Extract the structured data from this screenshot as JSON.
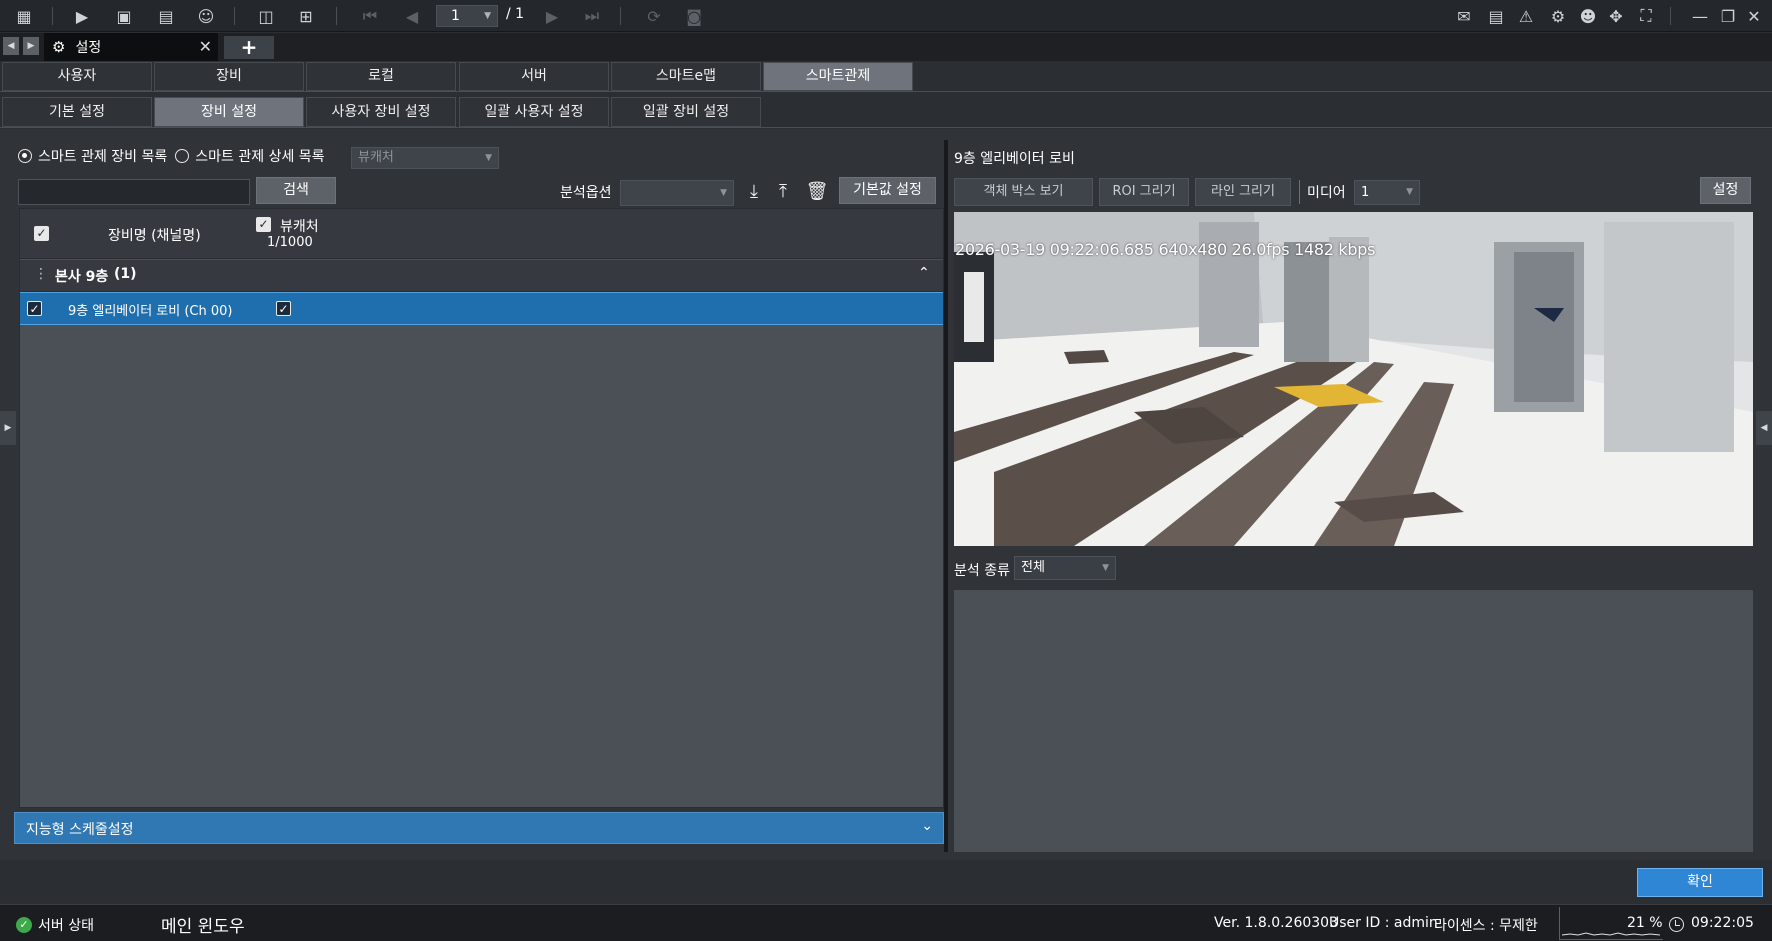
{
  "toolbar": {
    "page_current": "1",
    "page_total": "/ 1",
    "icons": [
      "grid-icon",
      "play-icon",
      "playback-search-icon",
      "export-icon",
      "person-search-icon",
      "layout-icon",
      "add-monitor-icon",
      "first-page-icon",
      "prev-page-icon",
      "next-page-icon",
      "last-page-icon",
      "refresh-monitor-icon",
      "snapshot-monitor-icon",
      "chat-icon",
      "message-icon",
      "alarm-icon",
      "settings-icon",
      "user-icon",
      "move-icon",
      "fullscreen-icon",
      "minimize-icon",
      "restore-icon",
      "close-icon"
    ]
  },
  "window_tab": {
    "title": "설정"
  },
  "category_tabs": [
    "사용자",
    "장비",
    "로컬",
    "서버",
    "스마트e맵",
    "스마트관제"
  ],
  "sub_tabs": [
    "기본 설정",
    "장비 설정",
    "사용자 장비 설정",
    "일괄 사용자 설정",
    "일괄 장비 설정"
  ],
  "left": {
    "radio1": "스마트 관제 장비 목록",
    "radio2": "스마트 관제 상세 목록",
    "analysis_type_select": "뷰캐처",
    "search_button": "검색",
    "analysis_option_label": "분석옵션",
    "default_button": "기본값 설정",
    "header_device": "장비명 (채널명)",
    "header_viewcatcher": "뷰캐처",
    "header_count": "1/1000",
    "group_name": "본사 9층",
    "group_count": "(1)",
    "device_name": "9층 엘리베이터 로비 (Ch 00)",
    "schedule_label": "지능형 스케줄설정"
  },
  "right": {
    "title": "9층 엘리베이터 로비",
    "btn_object_box": "객체 박스 보기",
    "btn_roi": "ROI 그리기",
    "btn_line": "라인 그리기",
    "media_label": "미디어",
    "media_value": "1",
    "settings_button": "설정",
    "video_overlay": "2026-03-19 09:22:06.685 640x480  26.0fps 1482 kbps",
    "analysis_kind_label": "분석 종류",
    "analysis_kind_value": "전체"
  },
  "confirm_button": "확인",
  "status": {
    "server_status": "서버 상태",
    "main_window": "메인 윈도우",
    "version": "Ver. 1.8.0.260303",
    "user_id": "User ID : admin",
    "license": "라이센스 : 무제한",
    "cpu": "21 %",
    "time": "09:22:05"
  },
  "colors": {
    "accent": "#2f78b3",
    "selected_row": "#1f6fae",
    "confirm": "#2f86d4",
    "status_ok": "#3ea84a"
  }
}
